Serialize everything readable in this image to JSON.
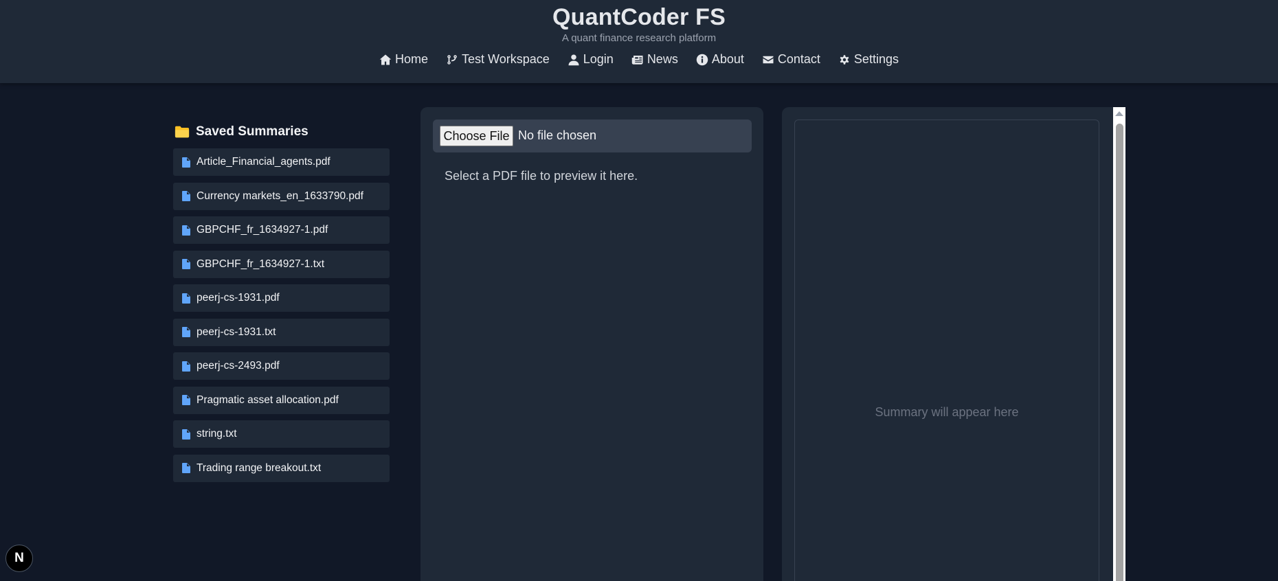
{
  "header": {
    "title": "QuantCoder FS",
    "subtitle": "A quant finance research platform"
  },
  "nav": [
    {
      "label": "Home",
      "icon": "home-icon"
    },
    {
      "label": "Test Workspace",
      "icon": "branch-icon"
    },
    {
      "label": "Login",
      "icon": "user-icon"
    },
    {
      "label": "News",
      "icon": "newspaper-icon"
    },
    {
      "label": "About",
      "icon": "info-icon"
    },
    {
      "label": "Contact",
      "icon": "envelope-icon"
    },
    {
      "label": "Settings",
      "icon": "gear-icon"
    }
  ],
  "sidebar": {
    "title": "Saved Summaries",
    "icon": "folder-icon",
    "files": [
      "Article_Financial_agents.pdf",
      "Currency markets_en_1633790.pdf",
      "GBPCHF_fr_1634927-1.pdf",
      "GBPCHF_fr_1634927-1.txt",
      "peerj-cs-1931.pdf",
      "peerj-cs-1931.txt",
      "peerj-cs-2493.pdf",
      "Pragmatic asset allocation.pdf",
      "string.txt",
      "Trading range breakout.txt"
    ]
  },
  "preview": {
    "choose_file_label": "Choose File",
    "file_status": "No file chosen",
    "hint": "Select a PDF file to preview it here."
  },
  "summary": {
    "placeholder": "Summary will appear here"
  },
  "badge": {
    "label": "N"
  },
  "colors": {
    "background": "#111827",
    "panel": "#1f2937",
    "accent_file_icon": "#60a5fa",
    "folder": "#fbbf24"
  }
}
